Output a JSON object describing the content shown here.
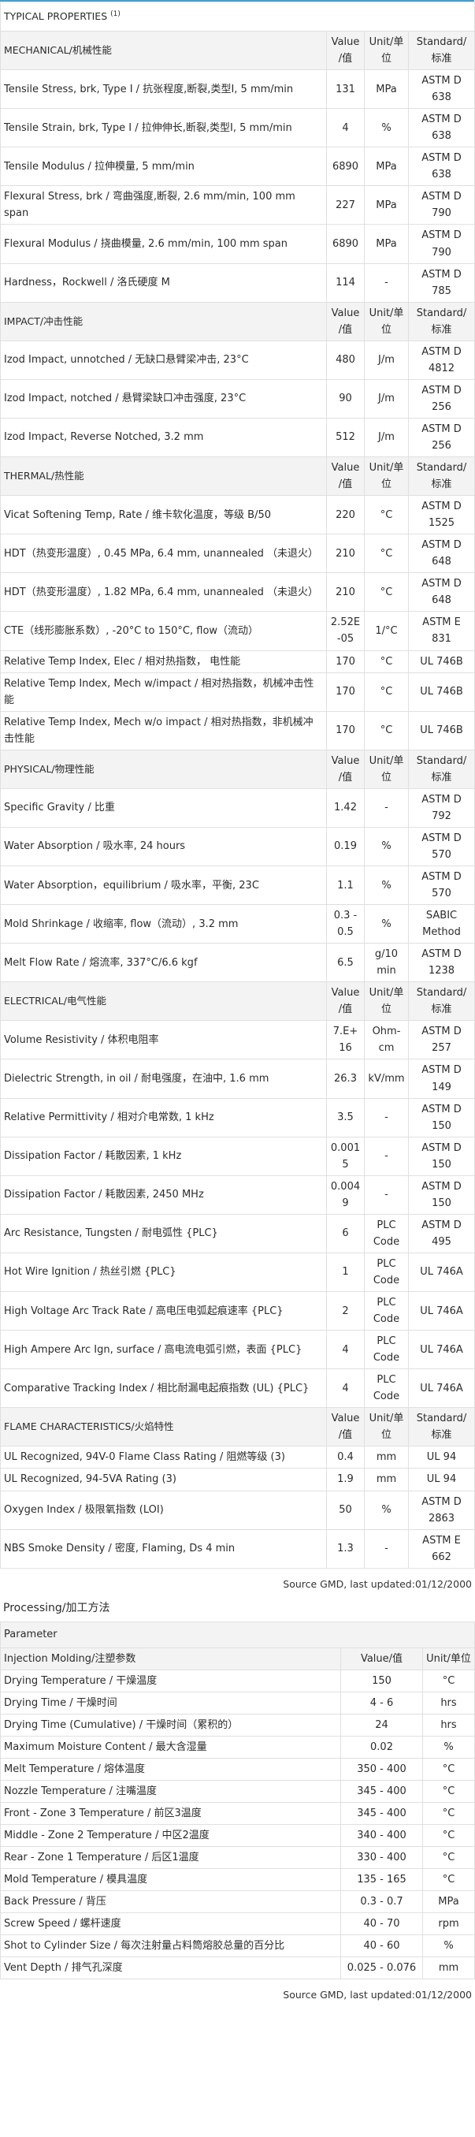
{
  "typical": {
    "title": "TYPICAL PROPERTIES",
    "title_sup": "(1)",
    "sections": [
      {
        "name": "MECHANICAL/机械性能",
        "h_value": "Value/值",
        "h_unit": "Unit/单位",
        "h_std": "Standard/标准",
        "rows": [
          {
            "p": "Tensile Stress, brk, Type I / 抗张程度,断裂,类型I, 5 mm/min",
            "v": "131",
            "u": "MPa",
            "s": "ASTM D 638"
          },
          {
            "p": "Tensile Strain, brk, Type I / 拉伸伸长,断裂,类型I, 5 mm/min",
            "v": "4",
            "u": "%",
            "s": "ASTM D 638"
          },
          {
            "p": "Tensile Modulus / 拉伸模量, 5 mm/min",
            "v": "6890",
            "u": "MPa",
            "s": "ASTM D 638"
          },
          {
            "p": "Flexural Stress, brk / 弯曲强度,断裂, 2.6 mm/min, 100 mm span",
            "v": "227",
            "u": "MPa",
            "s": "ASTM D 790"
          },
          {
            "p": "Flexural Modulus / 挠曲模量, 2.6 mm/min, 100 mm span",
            "v": "6890",
            "u": "MPa",
            "s": "ASTM D 790"
          },
          {
            "p": "Hardness，Rockwell / 洛氏硬度 M",
            "v": "114",
            "u": "-",
            "s": "ASTM D 785"
          }
        ]
      },
      {
        "name": "IMPACT/冲击性能",
        "h_value": "Value/值",
        "h_unit": "Unit/单位",
        "h_std": "Standard/标准",
        "rows": [
          {
            "p": "Izod Impact, unnotched / 无缺口悬臂梁冲击, 23°C",
            "v": "480",
            "u": "J/m",
            "s": "ASTM D 4812"
          },
          {
            "p": "Izod Impact, notched / 悬臂梁缺口冲击强度, 23°C",
            "v": "90",
            "u": "J/m",
            "s": "ASTM D 256"
          },
          {
            "p": "Izod Impact, Reverse Notched, 3.2 mm",
            "v": "512",
            "u": "J/m",
            "s": "ASTM D 256"
          }
        ]
      },
      {
        "name": "THERMAL/热性能",
        "h_value": "Value/值",
        "h_unit": "Unit/单位",
        "h_std": "Standard/标准",
        "rows": [
          {
            "p": "Vicat Softening Temp, Rate / 维卡软化温度，等级 B/50",
            "v": "220",
            "u": "°C",
            "s": "ASTM D 1525"
          },
          {
            "p": "HDT（热变形温度）, 0.45 MPa, 6.4 mm, unannealed （未退火）",
            "v": "210",
            "u": "°C",
            "s": "ASTM D 648"
          },
          {
            "p": "HDT（热变形温度）, 1.82 MPa, 6.4 mm, unannealed （未退火）",
            "v": "210",
            "u": "°C",
            "s": "ASTM D 648"
          },
          {
            "p": "CTE（线形膨胀系数）, -20°C to 150°C, flow（流动）",
            "v": "2.52E-05",
            "u": "1/°C",
            "s": "ASTM E 831"
          },
          {
            "p": "Relative Temp Index, Elec / 相对热指数，  电性能",
            "v": "170",
            "u": "°C",
            "s": "UL 746B"
          },
          {
            "p": "Relative Temp Index, Mech w/impact / 相对热指数，机械冲击性能",
            "v": "170",
            "u": "°C",
            "s": "UL 746B"
          },
          {
            "p": "Relative Temp Index, Mech w/o impact / 相对热指数，非机械冲击性能",
            "v": "170",
            "u": "°C",
            "s": "UL 746B"
          }
        ]
      },
      {
        "name": "PHYSICAL/物理性能",
        "h_value": "Value/值",
        "h_unit": "Unit/单位",
        "h_std": "Standard/标准",
        "rows": [
          {
            "p": "Specific Gravity / 比重",
            "v": "1.42",
            "u": "-",
            "s": "ASTM D 792"
          },
          {
            "p": "Water Absorption / 吸水率, 24 hours",
            "v": "0.19",
            "u": "%",
            "s": "ASTM D 570"
          },
          {
            "p": "Water Absorption，equilibrium / 吸水率，平衡, 23C",
            "v": "1.1",
            "u": "%",
            "s": "ASTM D 570"
          },
          {
            "p": "Mold Shrinkage / 收缩率, flow（流动）, 3.2 mm",
            "v": "0.3 - 0.5",
            "u": "%",
            "s": "SABIC Method"
          },
          {
            "p": "Melt Flow Rate / 熔流率, 337°C/6.6 kgf",
            "v": "6.5",
            "u": "g/10 min",
            "s": "ASTM D 1238"
          }
        ]
      },
      {
        "name": "ELECTRICAL/电气性能",
        "h_value": "Value/值",
        "h_unit": "Unit/单位",
        "h_std": "Standard/标准",
        "rows": [
          {
            "p": "Volume Resistivity / 体积电阻率",
            "v": "7.E+16",
            "u": "Ohm-cm",
            "s": "ASTM D 257"
          },
          {
            "p": "Dielectric Strength, in oil / 耐电强度，在油中, 1.6 mm",
            "v": "26.3",
            "u": "kV/mm",
            "s": "ASTM D 149"
          },
          {
            "p": "Relative Permittivity / 相对介电常数, 1 kHz",
            "v": "3.5",
            "u": "-",
            "s": "ASTM D 150"
          },
          {
            "p": "Dissipation Factor / 耗散因素, 1 kHz",
            "v": "0.0015",
            "u": "-",
            "s": "ASTM D 150"
          },
          {
            "p": "Dissipation Factor / 耗散因素, 2450 MHz",
            "v": "0.0049",
            "u": "-",
            "s": "ASTM D 150"
          },
          {
            "p": "Arc Resistance, Tungsten / 耐电弧性 {PLC}",
            "v": "6",
            "u": "PLC Code",
            "s": "ASTM D 495"
          },
          {
            "p": "Hot Wire Ignition / 热丝引燃 {PLC}",
            "v": "1",
            "u": "PLC Code",
            "s": "UL 746A"
          },
          {
            "p": "High Voltage Arc Track Rate / 高电压电弧起痕速率 {PLC}",
            "v": "2",
            "u": "PLC Code",
            "s": "UL 746A"
          },
          {
            "p": "High Ampere Arc Ign, surface / 高电流电弧引燃，表面 {PLC}",
            "v": "4",
            "u": "PLC Code",
            "s": "UL 746A"
          },
          {
            "p": "Comparative Tracking Index / 相比耐漏电起痕指数 (UL) {PLC}",
            "v": "4",
            "u": "PLC Code",
            "s": "UL 746A"
          }
        ]
      },
      {
        "name": "FLAME CHARACTERISTICS/火焰特性",
        "h_value": "Value/值",
        "h_unit": "Unit/单位",
        "h_std": "Standard/标准",
        "rows": [
          {
            "p": "UL Recognized, 94V-0 Flame Class Rating / 阻燃等级 (3)",
            "v": "0.4",
            "u": "mm",
            "s": "UL 94"
          },
          {
            "p": "UL Recognized, 94-5VA Rating (3)",
            "v": "1.9",
            "u": "mm",
            "s": "UL 94"
          },
          {
            "p": "Oxygen Index / 极限氧指数 (LOI)",
            "v": "50",
            "u": "%",
            "s": "ASTM D 2863"
          },
          {
            "p": "NBS Smoke Density / 密度, Flaming, Ds 4 min",
            "v": "1.3",
            "u": "-",
            "s": "ASTM E 662"
          }
        ]
      }
    ],
    "source": "Source GMD, last updated:01/12/2000"
  },
  "processing": {
    "title": "Processing/加工方法",
    "parameter_label": "Parameter",
    "section": "Injection Molding/注塑参数",
    "h_value": "Value/值",
    "h_unit": "Unit/单位",
    "rows": [
      {
        "p": "Drying Temperature / 干燥温度",
        "v": "150",
        "u": "°C"
      },
      {
        "p": "Drying Time / 干燥时间",
        "v": "4 - 6",
        "u": "hrs"
      },
      {
        "p": "Drying Time (Cumulative) / 干燥时间（累积的）",
        "v": "24",
        "u": "hrs"
      },
      {
        "p": "Maximum Moisture Content / 最大含湿量",
        "v": "0.02",
        "u": "%"
      },
      {
        "p": "Melt Temperature / 熔体温度",
        "v": "350 - 400",
        "u": "°C"
      },
      {
        "p": "Nozzle Temperature / 注嘴温度",
        "v": "345 - 400",
        "u": "°C"
      },
      {
        "p": "Front - Zone 3 Temperature / 前区3温度",
        "v": "345 - 400",
        "u": "°C"
      },
      {
        "p": "Middle - Zone 2 Temperature / 中区2温度",
        "v": "340 - 400",
        "u": "°C"
      },
      {
        "p": "Rear - Zone 1 Temperature / 后区1温度",
        "v": "330 - 400",
        "u": "°C"
      },
      {
        "p": "Mold Temperature / 模具温度",
        "v": "135 - 165",
        "u": "°C"
      },
      {
        "p": "Back Pressure / 背压",
        "v": "0.3 - 0.7",
        "u": "MPa"
      },
      {
        "p": "Screw Speed / 螺杆速度",
        "v": "40 - 70",
        "u": "rpm"
      },
      {
        "p": "Shot to Cylinder Size / 每次注射量占料筒熔胶总量的百分比",
        "v": "40 - 60",
        "u": "%"
      },
      {
        "p": "Vent Depth / 排气孔深度",
        "v": "0.025 - 0.076",
        "u": "mm"
      }
    ],
    "source": "Source GMD, last updated:01/12/2000"
  }
}
